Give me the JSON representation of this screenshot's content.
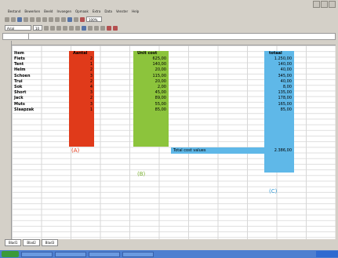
{
  "menu": [
    "Bestand",
    "Bewerken",
    "Beeld",
    "Invoegen",
    "Opmaak",
    "Extra",
    "Data",
    "Venster",
    "Help"
  ],
  "toolbar": {
    "zoom": "100%",
    "font": "Arial",
    "size": "10"
  },
  "table": {
    "headers": {
      "item": "Item",
      "qty": "Aantal",
      "unit_cost": "Unit cost",
      "total": "totaal"
    },
    "rows": [
      {
        "item": "Fiets",
        "qty": "2",
        "unit_cost": "625,00",
        "total": "1.250,00"
      },
      {
        "item": "Tent",
        "qty": "1",
        "unit_cost": "140,00",
        "total": "140,00"
      },
      {
        "item": "Helm",
        "qty": "2",
        "unit_cost": "20,00",
        "total": "40,00"
      },
      {
        "item": "Schoen",
        "qty": "3",
        "unit_cost": "115,00",
        "total": "345,00"
      },
      {
        "item": "Trui",
        "qty": "2",
        "unit_cost": "20,00",
        "total": "40,00"
      },
      {
        "item": "Sok",
        "qty": "4",
        "unit_cost": "2,00",
        "total": "8,00"
      },
      {
        "item": "Short",
        "qty": "3",
        "unit_cost": "45,00",
        "total": "135,00"
      },
      {
        "item": "Jack",
        "qty": "2",
        "unit_cost": "89,00",
        "total": "178,00"
      },
      {
        "item": "Muts",
        "qty": "3",
        "unit_cost": "55,00",
        "total": "165,00"
      },
      {
        "item": "Slaapzak",
        "qty": "1",
        "unit_cost": "85,00",
        "total": "85,00"
      }
    ],
    "total_label": "Total cost values",
    "total_value": "2.386,00"
  },
  "annotations": {
    "a": "(A)",
    "b": "(B)",
    "c": "(C)"
  },
  "sheet_tabs": [
    "Blad1",
    "Blad2",
    "Blad3"
  ],
  "colors": {
    "qty": "#e03a1a",
    "unit_cost": "#8cc43c",
    "total": "#5fb8e8",
    "annotation_a": "#e03a1a",
    "annotation_b": "#7ab030",
    "annotation_c": "#3a9ed8"
  }
}
